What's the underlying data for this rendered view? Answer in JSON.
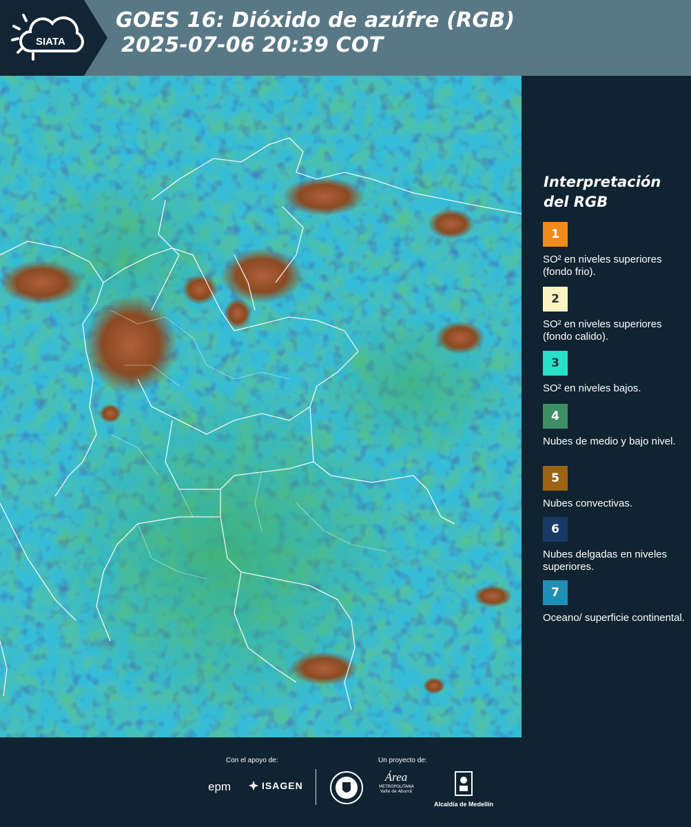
{
  "header": {
    "logo_text": "SIATA",
    "title_line1": "GOES 16: Dióxido de azúfre (RGB)",
    "title_line2": "2025-07-06 20:39 COT"
  },
  "legend": {
    "title": "Interpretación del RGB",
    "items": [
      {
        "number": "1",
        "color": "#f28a1c",
        "text_color": "#ffffff",
        "description": "SO² en niveles superiores (fondo frio)."
      },
      {
        "number": "2",
        "color": "#fbf2c2",
        "text_color": "#333333",
        "description": "SO² en niveles superiores (fondo calido)."
      },
      {
        "number": "3",
        "color": "#27e0c9",
        "text_color": "#1a3a3a",
        "description": "SO² en niveles bajos."
      },
      {
        "number": "4",
        "color": "#3f8f66",
        "text_color": "#ffffff",
        "description": "Nubes de medio y bajo nivel."
      },
      {
        "number": "5",
        "color": "#9d6312",
        "text_color": "#ffffff",
        "description": "Nubes convectivas."
      },
      {
        "number": "6",
        "color": "#173a66",
        "text_color": "#ffffff",
        "description": "Nubes delgadas en niveles superiores."
      },
      {
        "number": "7",
        "color": "#1f8fb5",
        "text_color": "#ffffff",
        "description": "Oceano/ superficie continental."
      }
    ]
  },
  "footer": {
    "support_label": "Con el apoyo de:",
    "project_label": "Un proyecto de:",
    "sponsors": [
      "epm",
      "ISAGEN"
    ],
    "partners": {
      "area": "Área",
      "area_sub": "METROPOLITANA Valle de Aburrá",
      "alcaldia": "Alcaldía de Medellín"
    }
  },
  "colors": {
    "header_bg": "#587885",
    "panel_bg": "#0f2331",
    "ocean": "#2fb6d6"
  }
}
